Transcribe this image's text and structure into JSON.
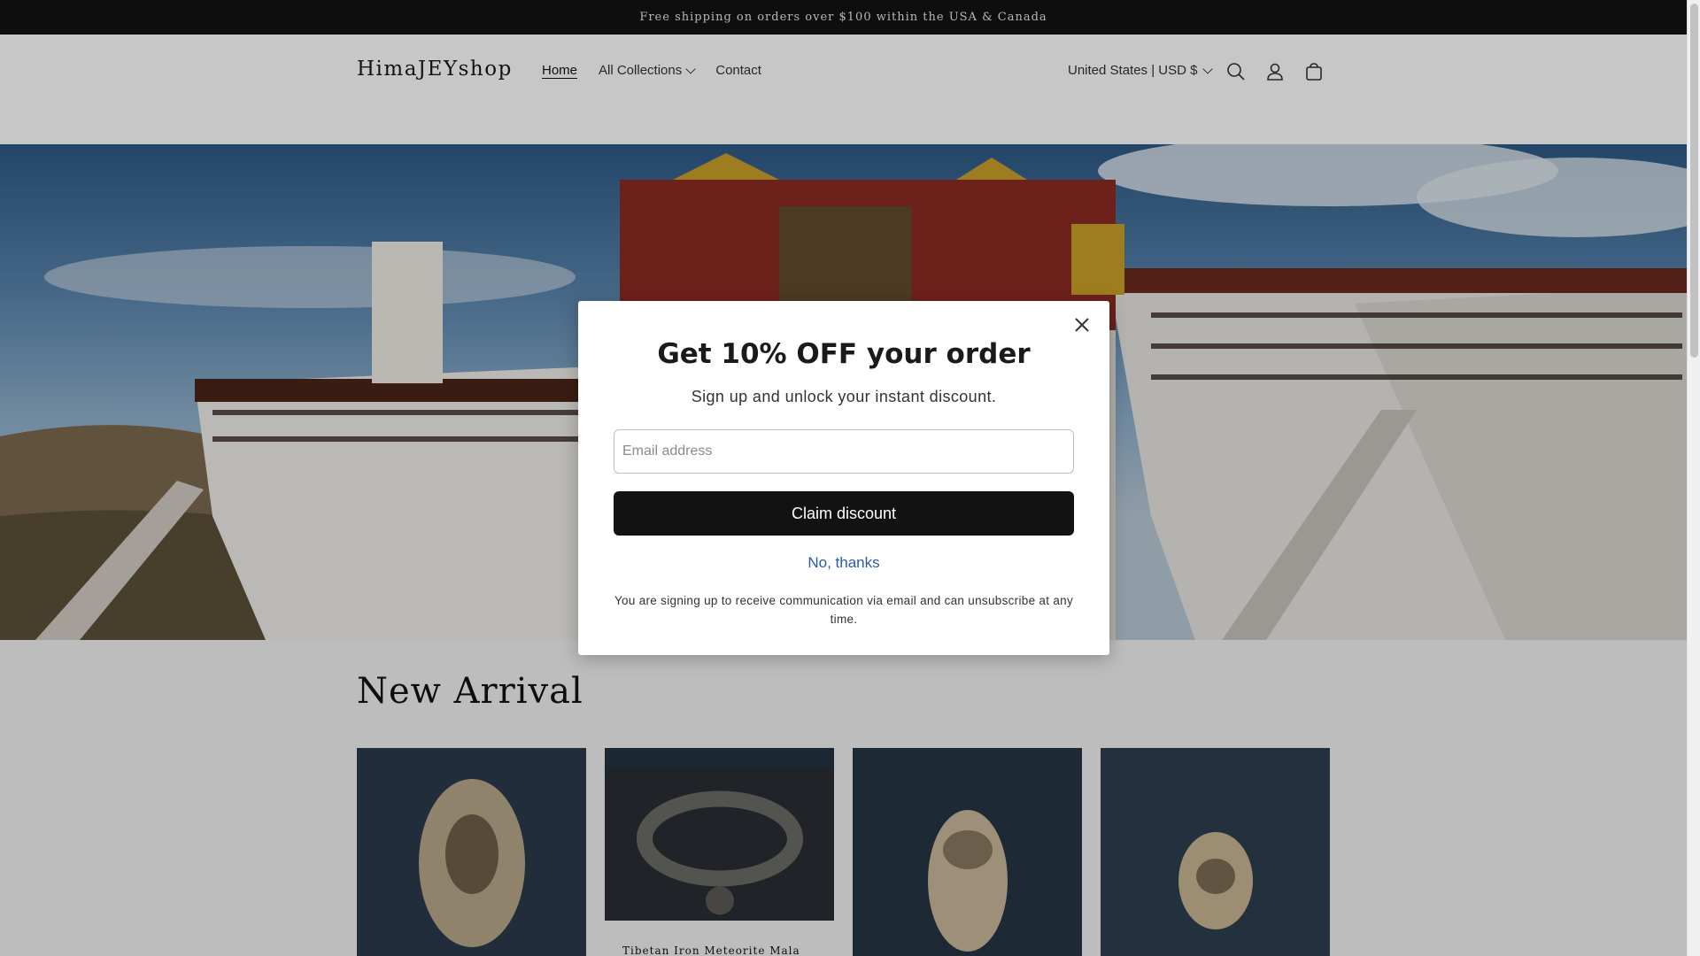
{
  "announcement": "Free shipping on orders over $100 within the USA & Canada",
  "header": {
    "logo": "HimaJEYshop",
    "nav": [
      {
        "label": "Home"
      },
      {
        "label": "All Collections"
      },
      {
        "label": "Contact"
      }
    ],
    "currency": "United States | USD $",
    "icons": [
      "search-icon",
      "account-icon",
      "cart-icon"
    ]
  },
  "hero": {
    "image": "tibetan-palace-photo"
  },
  "section": {
    "title": "New Arrival"
  },
  "products": [
    {
      "title": ""
    },
    {
      "title": "Tibetan Iron Meteorite Mala"
    },
    {
      "title": ""
    },
    {
      "title": ""
    }
  ],
  "popup": {
    "title": "Get 10% OFF your order",
    "subtitle": "Sign up and unlock your instant discount.",
    "email_placeholder": "Email address",
    "claim_label": "Claim discount",
    "decline_label": "No, thanks",
    "disclaimer": "You are signing up to receive communication via email and can unsubscribe at any time."
  },
  "colors": {
    "announcement_bg": "#121212",
    "button_bg": "#121212",
    "link": "#2a5aa8"
  }
}
